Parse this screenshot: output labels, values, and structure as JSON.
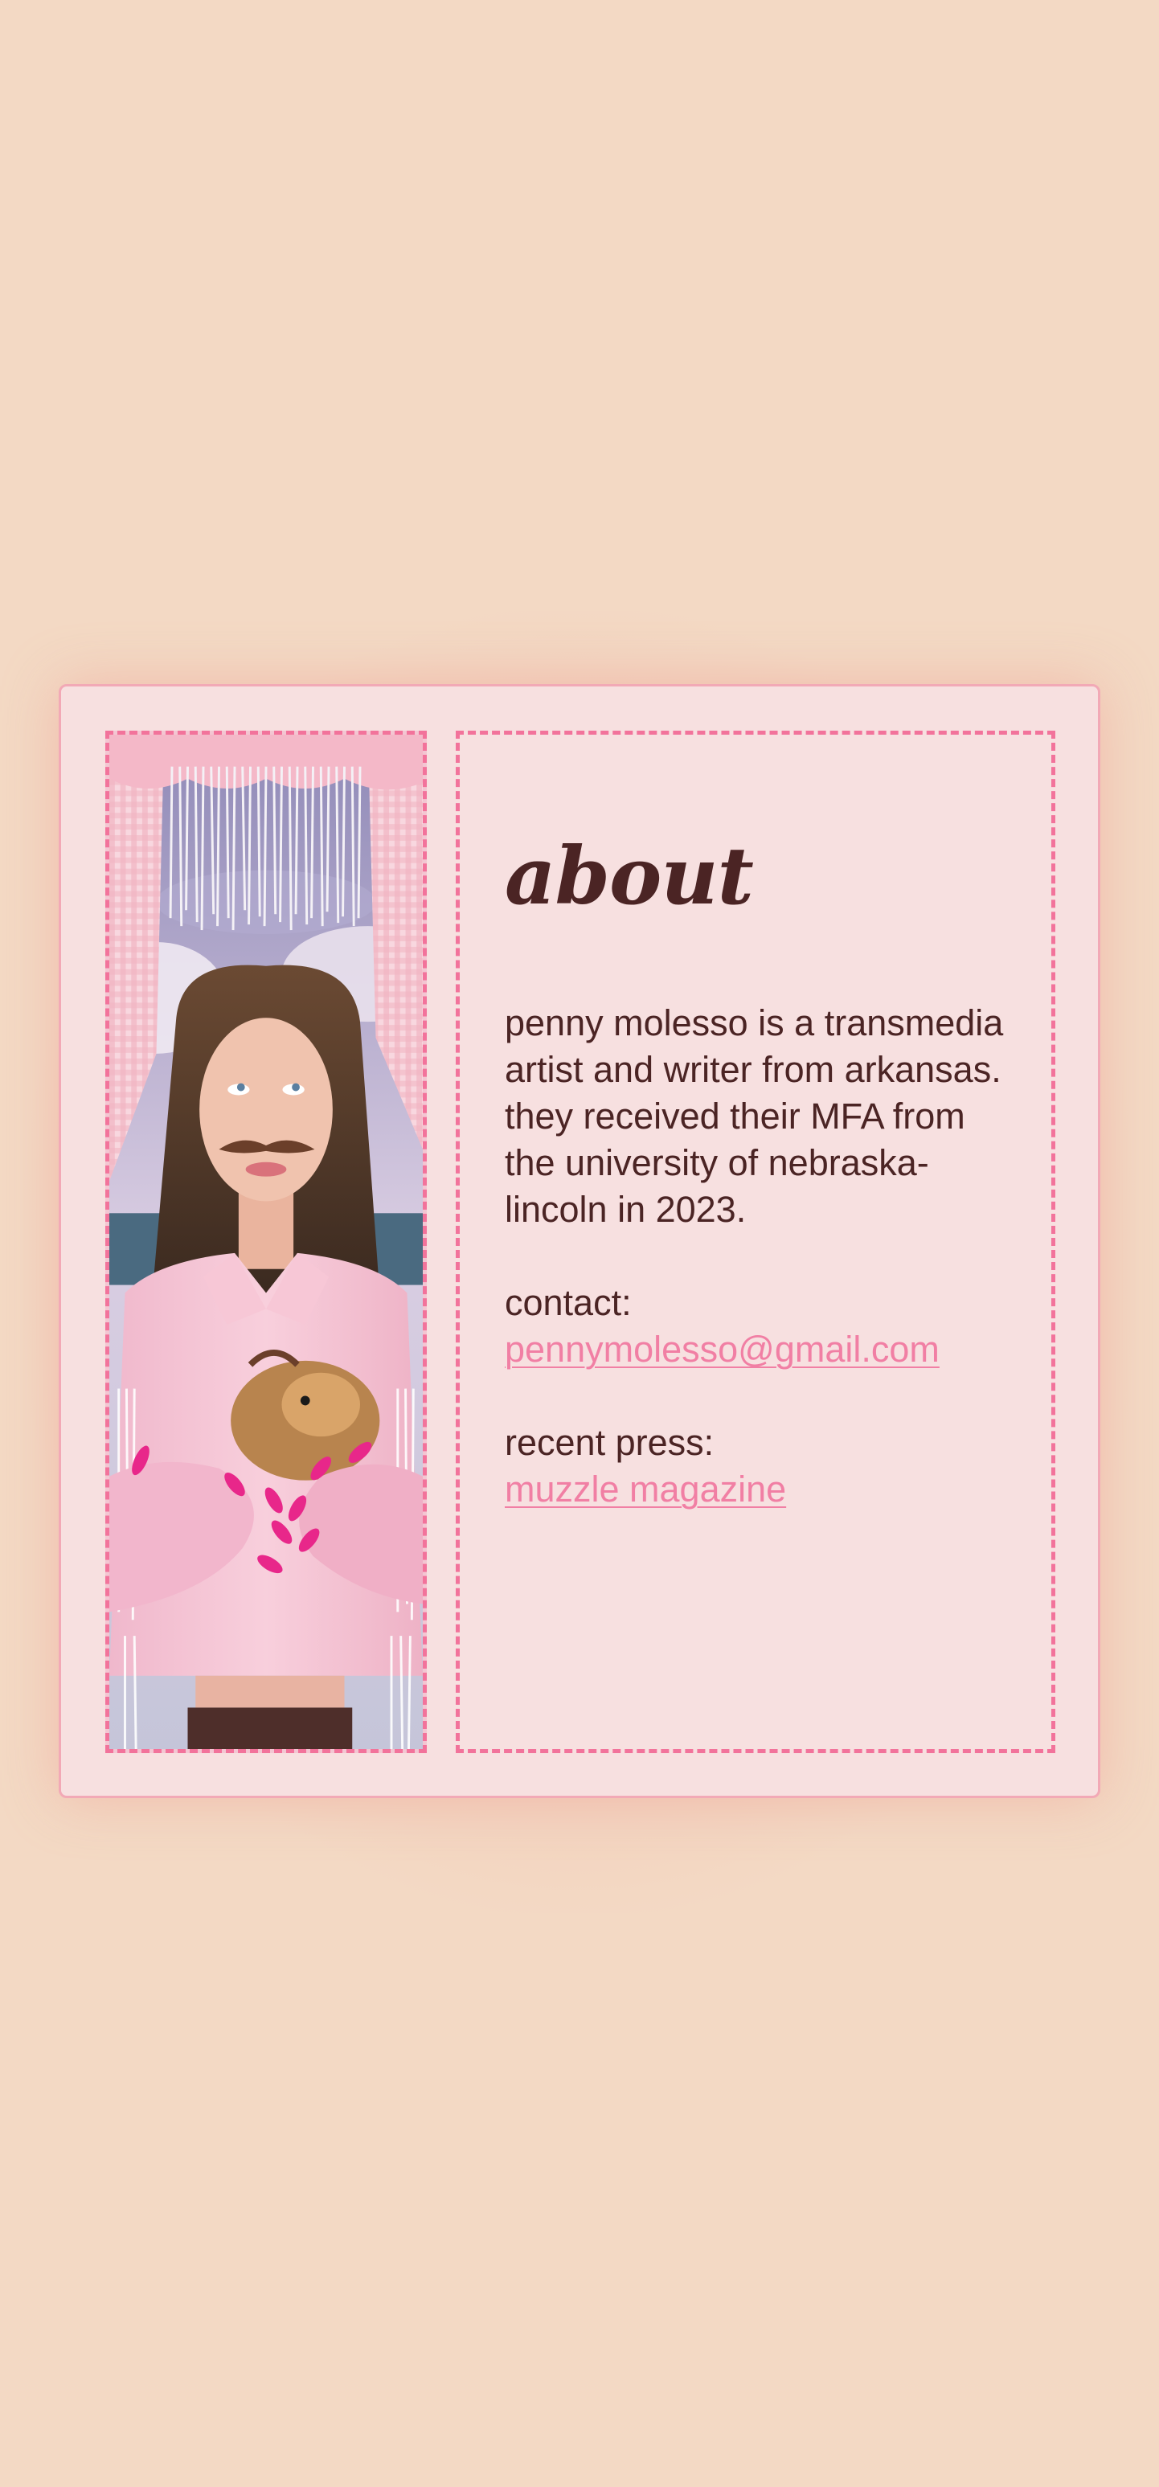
{
  "about": {
    "heading": "about",
    "bio": "penny molesso is a transmedia artist and writer from arkansas. they received their MFA from the university of nebraska-lincoln in 2023.",
    "contact_label": "contact:",
    "contact_email": "pennymolesso@gmail.com",
    "press_label": "recent press:",
    "press_link": "muzzle magazine"
  },
  "colors": {
    "page_background": "#f3d9c4",
    "card_background": "#f7e0e0",
    "dashed_border": "#f2739b",
    "text": "#4b2424",
    "link": "#f17fa4"
  },
  "photo": {
    "description_icon": "portrait-photo"
  }
}
